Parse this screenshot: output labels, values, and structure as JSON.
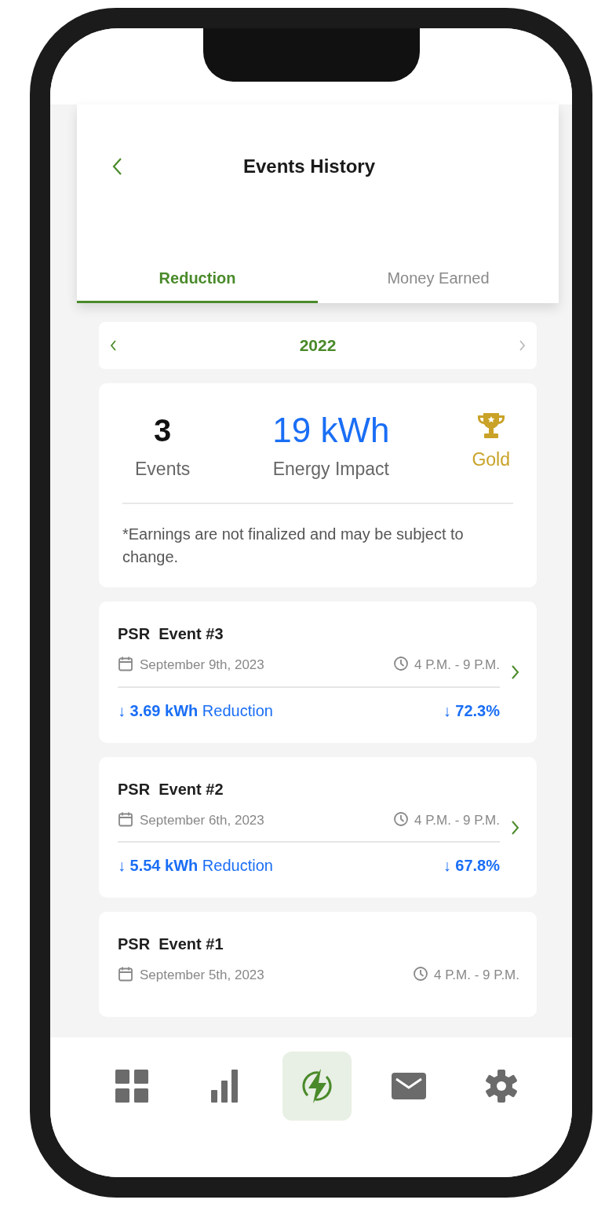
{
  "header": {
    "title": "Events History"
  },
  "tabs": [
    {
      "label": "Reduction",
      "selected": true
    },
    {
      "label": "Money Earned",
      "selected": false
    }
  ],
  "year_selector": {
    "year": "2022"
  },
  "summary": {
    "events_count": "3",
    "events_label": "Events",
    "energy_value": "19 kWh",
    "energy_label": "Energy Impact",
    "badge_label": "Gold",
    "note": "*Earnings are not finalized and may be subject to change."
  },
  "events": [
    {
      "title": "PSR  Event #3",
      "date": "September 9th, 2023",
      "time": "4 P.M. - 9 P.M.",
      "reduction": "↓ **3.69 kWh** Reduction",
      "percent": "↓ **72.3%**"
    },
    {
      "title": "PSR  Event #2",
      "date": "September 6th, 2023",
      "time": "4 P.M. - 9 P.M.",
      "reduction": "↓ **5.54 kWh** Reduction",
      "percent": "↓ **67.8%**"
    },
    {
      "title": "PSR  Event #1",
      "date": "September 5th, 2023",
      "time": "4 P.M. - 9 P.M."
    }
  ],
  "nav": [
    {
      "kind": "grid",
      "selected": false
    },
    {
      "kind": "bars",
      "selected": false
    },
    {
      "kind": "bolt",
      "selected": true
    },
    {
      "kind": "mail",
      "selected": false
    },
    {
      "kind": "gear",
      "selected": false
    }
  ]
}
